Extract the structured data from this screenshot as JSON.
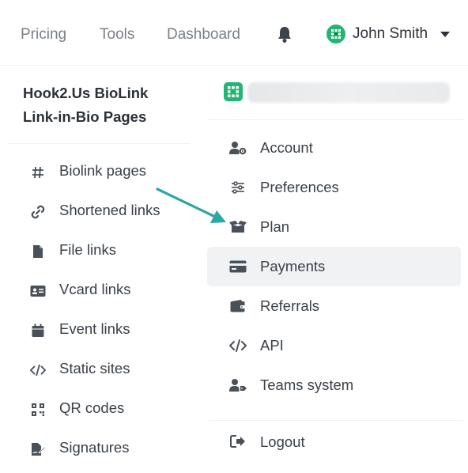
{
  "nav": {
    "links": [
      "Pricing",
      "Tools",
      "Dashboard"
    ],
    "user_name": "John Smith"
  },
  "brand": {
    "line1": "Hook2.Us BioLink",
    "line2": "Link-in-Bio Pages"
  },
  "left_menu": [
    {
      "label": "Biolink pages",
      "icon": "hash-icon"
    },
    {
      "label": "Shortened links",
      "icon": "link-icon"
    },
    {
      "label": "File links",
      "icon": "file-icon"
    },
    {
      "label": "Vcard links",
      "icon": "id-card-icon"
    },
    {
      "label": "Event links",
      "icon": "calendar-icon"
    },
    {
      "label": "Static sites",
      "icon": "code-icon"
    },
    {
      "label": "QR codes",
      "icon": "qr-code-icon"
    },
    {
      "label": "Signatures",
      "icon": "signature-icon"
    }
  ],
  "account_menu": [
    {
      "label": "Account",
      "icon": "user-cog-icon"
    },
    {
      "label": "Preferences",
      "icon": "sliders-icon"
    },
    {
      "label": "Plan",
      "icon": "box-open-icon"
    },
    {
      "label": "Payments",
      "icon": "credit-card-icon",
      "active": true
    },
    {
      "label": "Referrals",
      "icon": "wallet-icon"
    },
    {
      "label": "API",
      "icon": "code-icon"
    },
    {
      "label": "Teams system",
      "icon": "user-tag-icon"
    }
  ],
  "logout_label": "Logout",
  "colors": {
    "accent_arrow": "#2ea6a6",
    "avatar": "#22b573",
    "active_bg": "#f1f2f4"
  }
}
